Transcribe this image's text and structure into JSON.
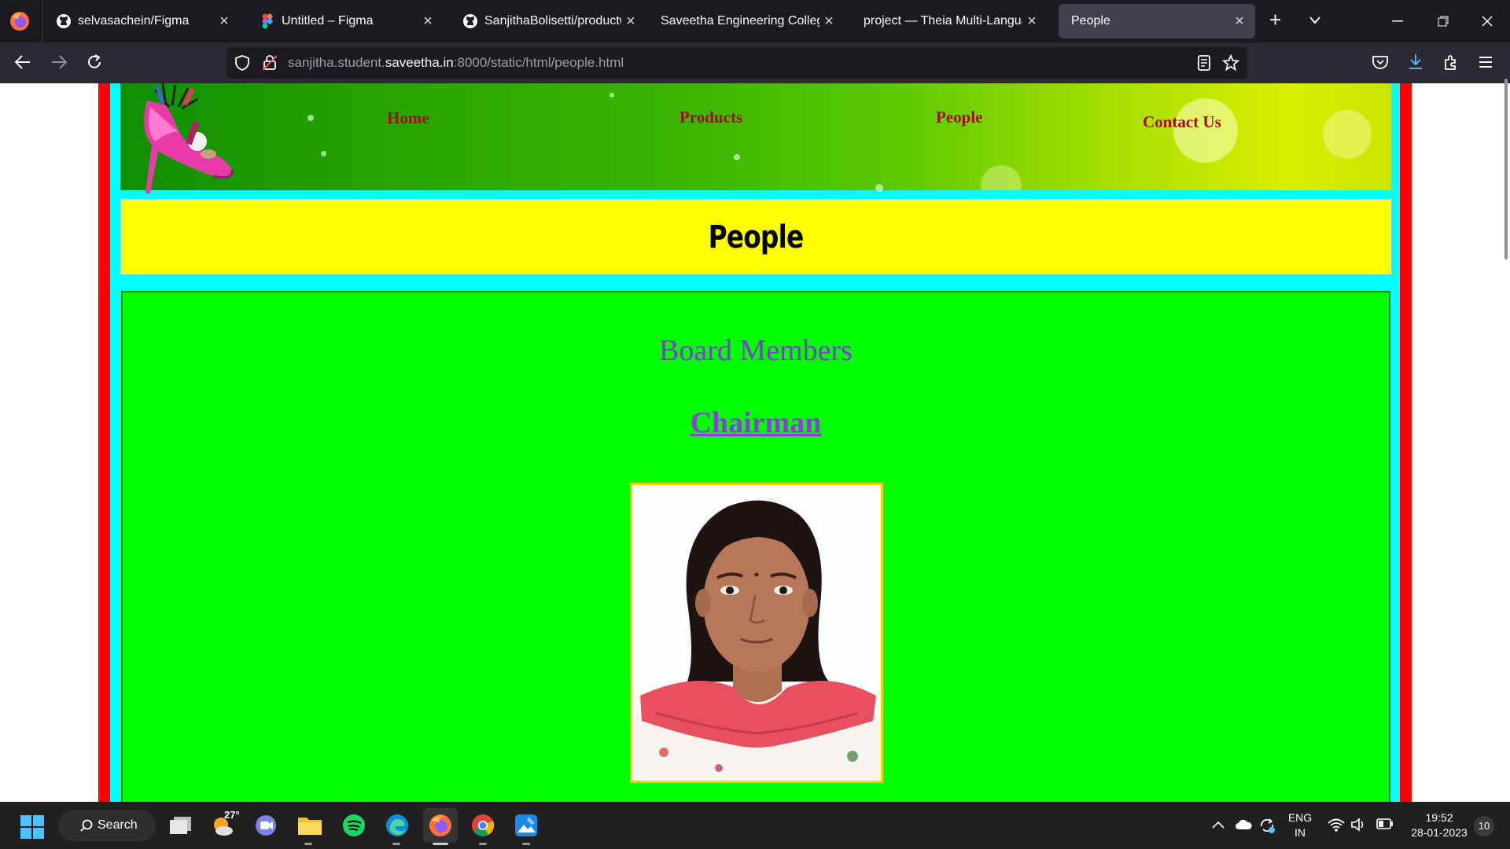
{
  "browser": {
    "tabs": [
      {
        "title": "selvasachein/Figma",
        "icon": "github-icon",
        "active": false
      },
      {
        "title": "Untitled – Figma",
        "icon": "figma-icon",
        "active": false
      },
      {
        "title": "SanjithaBolisetti/productwe",
        "icon": "github-icon",
        "active": false
      },
      {
        "title": "Saveetha Engineering College",
        "icon": "",
        "active": false
      },
      {
        "title": "project — Theia Multi-Language",
        "icon": "",
        "active": false
      },
      {
        "title": "People",
        "icon": "",
        "active": true
      }
    ],
    "close_glyph": "×",
    "new_tab_glyph": "+",
    "url_prefix": "sanjitha.student.",
    "url_host": "saveetha.in",
    "url_suffix": ":8000/static/html/people.html"
  },
  "site": {
    "nav": {
      "home": "Home",
      "products": "Products",
      "people": "People",
      "contact": "Contact Us"
    },
    "page_title": "People",
    "section_heading": "Board Members",
    "role_heading": "Chairman"
  },
  "taskbar": {
    "search_label": "Search",
    "weather_temp": "27°",
    "lang_line1": "ENG",
    "lang_line2": "IN",
    "time": "19:52",
    "date": "28-01-2023",
    "notification_count": "10"
  },
  "colors": {
    "page_frame_outer": "#ff0000",
    "page_frame_inner": "#00ffff",
    "title_bg": "#ffff00",
    "content_bg": "#00ff00",
    "nav_link": "#a01010",
    "heading_purple": "#7a3fd0"
  }
}
